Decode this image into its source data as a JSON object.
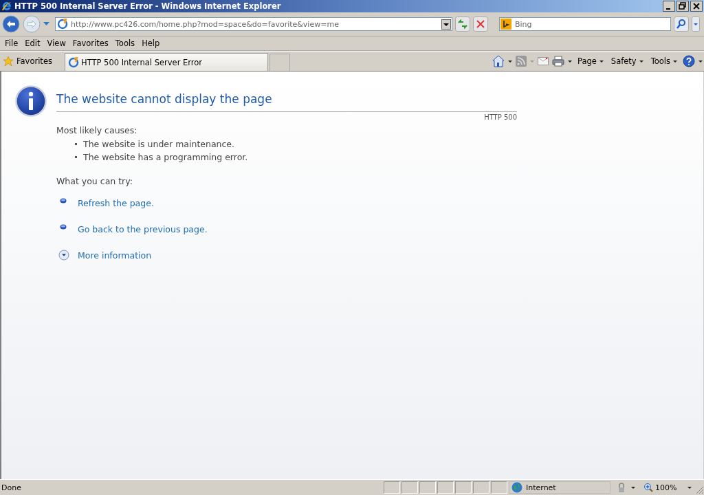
{
  "window": {
    "title": "HTTP 500 Internal Server Error - Windows Internet Explorer"
  },
  "address_bar": {
    "url": "http://www.pc426.com/home.php?mod=space&do=favorite&view=me"
  },
  "search": {
    "placeholder": "Bing"
  },
  "menu": [
    "File",
    "Edit",
    "View",
    "Favorites",
    "Tools",
    "Help"
  ],
  "favorites_bar": {
    "label": "Favorites",
    "tabs": [
      {
        "label": "HTTP 500 Internal Server Error",
        "selected": true
      }
    ]
  },
  "command_bar": [
    "Page",
    "Safety",
    "Tools"
  ],
  "page": {
    "heading": "The website cannot display the page",
    "code": "HTTP 500",
    "causes_title": "Most likely causes:",
    "causes": [
      "The website is under maintenance.",
      "The website has a programming error."
    ],
    "try_title": "What you can try:",
    "actions": [
      {
        "kind": "link",
        "label": "Refresh the page."
      },
      {
        "kind": "link",
        "label": "Go back to the previous page."
      },
      {
        "kind": "expand",
        "label": "More information",
        "expanded": false
      }
    ]
  },
  "status_bar": {
    "text": "Done",
    "zone": "Internet",
    "zoom": "100%"
  }
}
